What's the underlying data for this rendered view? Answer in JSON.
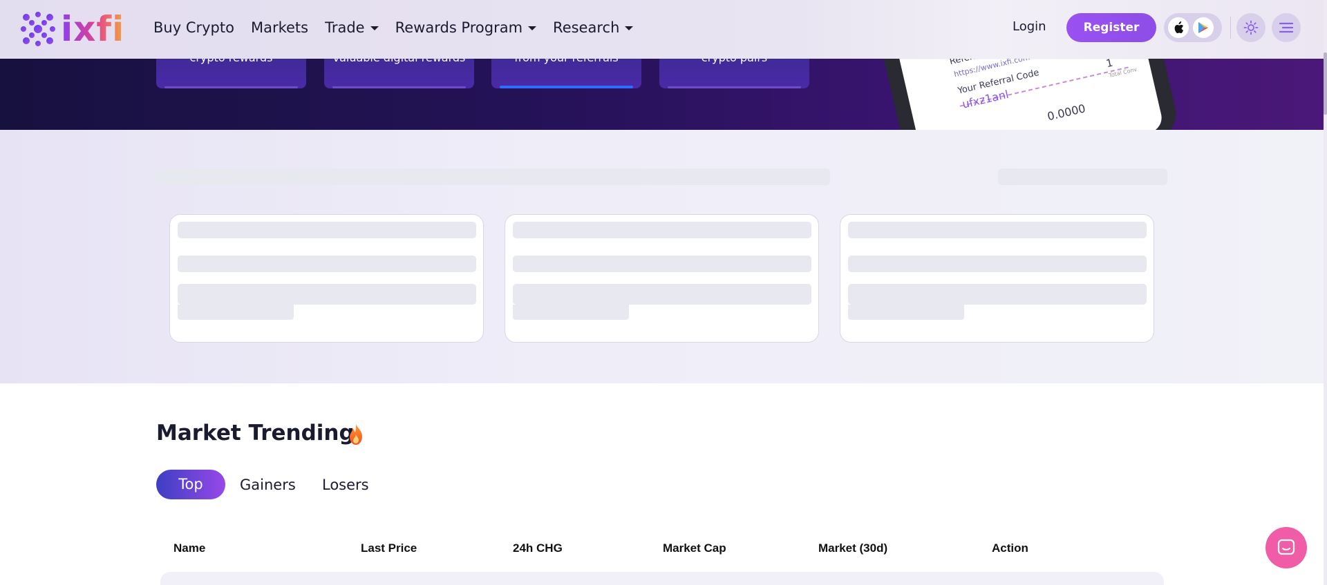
{
  "brand": {
    "name": "ixfi"
  },
  "nav": {
    "items": [
      {
        "label": "Buy Crypto",
        "has_dropdown": false
      },
      {
        "label": "Markets",
        "has_dropdown": false
      },
      {
        "label": "Trade",
        "has_dropdown": true
      },
      {
        "label": "Rewards Program",
        "has_dropdown": true
      },
      {
        "label": "Research",
        "has_dropdown": true
      }
    ],
    "login_label": "Login",
    "register_label": "Register"
  },
  "hero": {
    "cards": [
      {
        "label": "crypto rewards"
      },
      {
        "label": "valuable digital rewards"
      },
      {
        "label": "from your referrals",
        "active": true
      },
      {
        "label": "crypto pairs"
      }
    ],
    "phone": {
      "line1": "Referr",
      "link": "https://www.ixfi.com",
      "code_label": "Your Referral Code",
      "code_value": "ufxz1anl",
      "count": "1",
      "count_label": "Total Conv",
      "amount": "0.0000"
    }
  },
  "market": {
    "title": "Market Trending",
    "tabs": [
      "Top",
      "Gainers",
      "Losers"
    ],
    "active_tab": "Top",
    "columns": [
      "Name",
      "Last Price",
      "24h CHG",
      "Market Cap",
      "Market (30d)",
      "Action"
    ]
  },
  "colors": {
    "accent": "#9a51f2",
    "hero_bg": "#241257",
    "chat_button": "#f05da6"
  }
}
